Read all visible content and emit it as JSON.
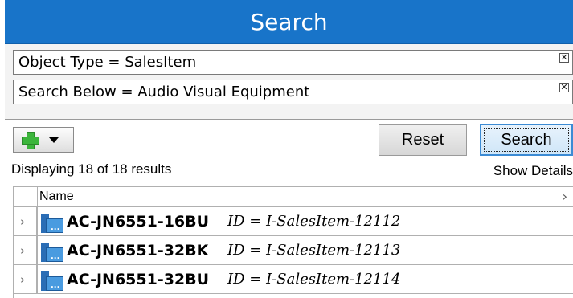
{
  "header": {
    "title": "Search"
  },
  "filters": [
    {
      "label": "Object Type = SalesItem",
      "remove_glyph": "✕"
    },
    {
      "label": "Search Below = Audio Visual Equipment",
      "remove_glyph": "✕"
    }
  ],
  "toolbar": {
    "add_icon": "plus-icon",
    "dropdown_icon": "caret-down-icon",
    "reset_label": "Reset",
    "search_label": "Search"
  },
  "results": {
    "summary": "Displaying 18 of 18 results",
    "show_details_label": "Show Details"
  },
  "grid": {
    "column_name": "Name",
    "header_chevron": "›",
    "rows": [
      {
        "expand": "›",
        "name": "AC-JN6551-16BU",
        "id_text": "ID = I-SalesItem-12112"
      },
      {
        "expand": "›",
        "name": "AC-JN6551-32BK",
        "id_text": "ID = I-SalesItem-12113"
      },
      {
        "expand": "›",
        "name": "AC-JN6551-32BU",
        "id_text": "ID = I-SalesItem-12114"
      }
    ]
  },
  "colors": {
    "header_bg": "#1874c9",
    "add_icon": "#3cb53c",
    "item_icon": "#4a9be0"
  }
}
